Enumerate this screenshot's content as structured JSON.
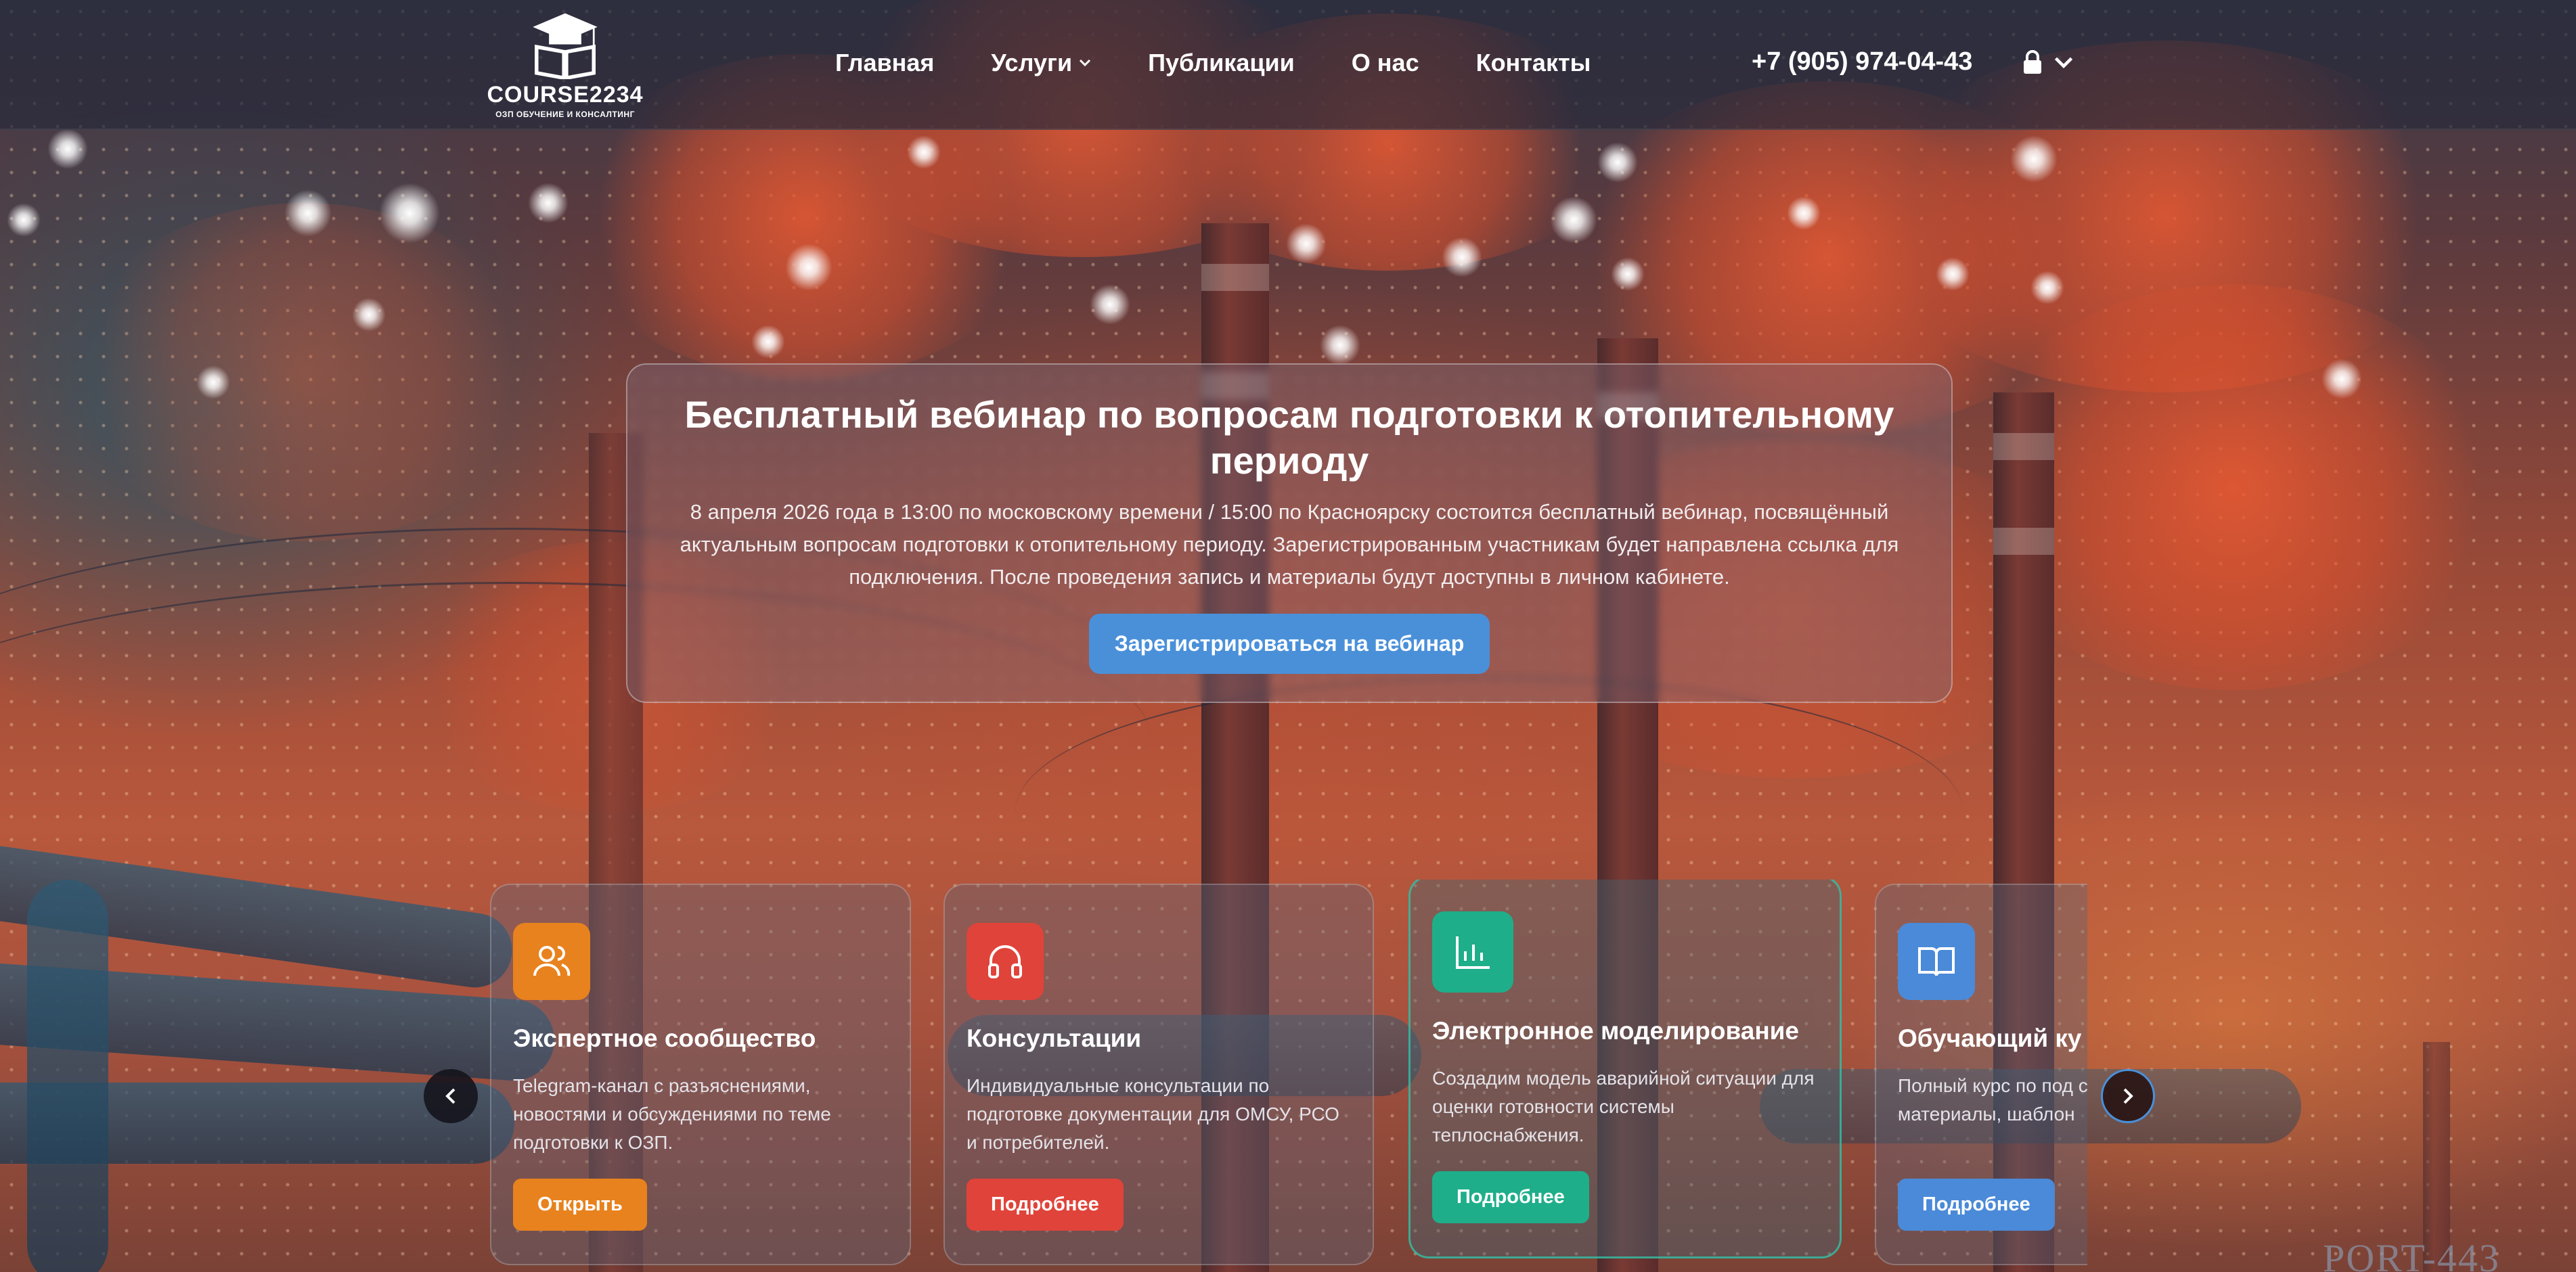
{
  "header": {
    "logo": {
      "title": "COURSE2234",
      "subtitle": "ОЗП ОБУЧЕНИЕ И КОНСАЛТИНГ"
    },
    "nav": [
      {
        "label": "Главная",
        "has_dropdown": false
      },
      {
        "label": "Услуги",
        "has_dropdown": true
      },
      {
        "label": "Публикации",
        "has_dropdown": false
      },
      {
        "label": "О нас",
        "has_dropdown": false
      },
      {
        "label": "Контакты",
        "has_dropdown": false
      }
    ],
    "phone": "+7 (905) 974-04-43",
    "account_icon": "lock-icon"
  },
  "hero": {
    "title": "Бесплатный вебинар по вопросам подготовки к отопительному периоду",
    "text": "8 апреля 2026 года в 13:00 по московскому времени / 15:00 по Красноярску состоится бесплатный вебинар, посвящённый актуальным вопросам подготовки к отопительному периоду. Зарегистрированным участникам будет направлена ссылка для подключения. После проведения запись и материалы будут доступны в личном кабинете.",
    "button_label": "Зарегистрироваться на вебинар",
    "button_color": "#4a90d9"
  },
  "carousel": {
    "cards": [
      {
        "icon": "users-icon",
        "icon_color": "#e8821e",
        "title": "Экспертное сообщество",
        "description": "Telegram-канал с разъяснениями, новостями и обсуждениями по теме подготовки к ОЗП.",
        "button_label": "Открыть",
        "button_color": "#e8821e"
      },
      {
        "icon": "headphones-icon",
        "icon_color": "#e0433a",
        "title": "Консультации",
        "description": "Индивидуальные консультации по подготовке документации для ОМСУ, РСО и потребителей.",
        "button_label": "Подробнее",
        "button_color": "#e0433a"
      },
      {
        "icon": "bar-chart-icon",
        "icon_color": "#1fae8a",
        "title": "Электронное моделирование",
        "description": "Создадим модель аварийной ситуации для оценки готовности системы теплоснабжения.",
        "button_label": "Подробнее",
        "button_color": "#1fae8a"
      },
      {
        "icon": "book-icon",
        "icon_color": "#4a8ad8",
        "title": "Обучающий ку",
        "description": "Полный курс по под согласно Приказу № материалы, шаблон",
        "button_label": "Подробнее",
        "button_color": "#4a8ad8"
      }
    ],
    "prev_icon": "chevron-left-icon",
    "next_icon": "chevron-right-icon"
  },
  "watermark": "PORT-443"
}
